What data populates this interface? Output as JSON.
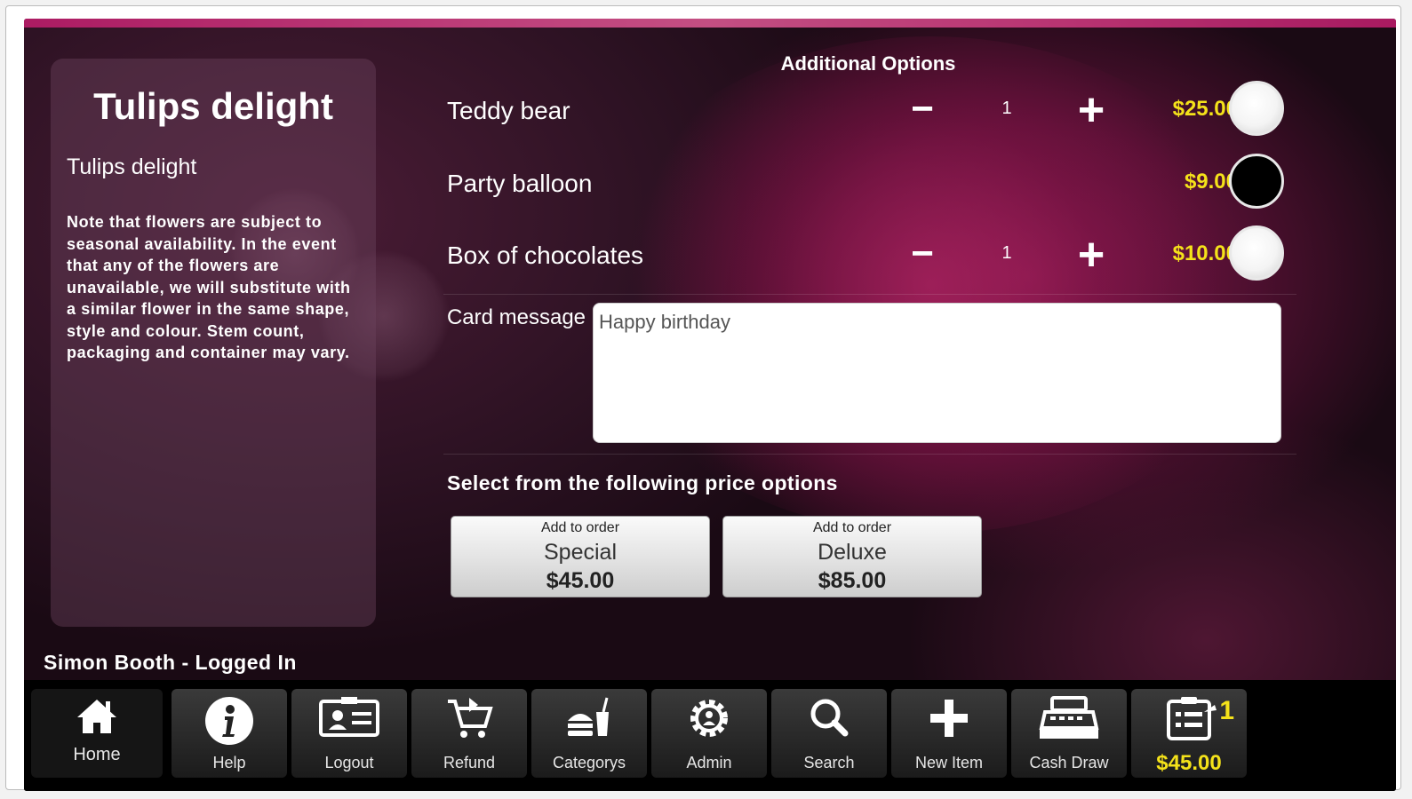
{
  "product": {
    "title": "Tulips delight",
    "subtitle": "Tulips delight",
    "description": "Note that flowers are subject to seasonal availability. In the event that any of the flowers are unavailable, we will substitute with a similar flower in the same shape, style and colour. Stem count, packaging and container may vary."
  },
  "options": {
    "heading": "Additional Options",
    "items": [
      {
        "label": "Teddy bear",
        "quantity": "1",
        "price": "$25.00",
        "has_stepper": true,
        "selected": true
      },
      {
        "label": "Party balloon",
        "price": "$9.00",
        "has_stepper": false,
        "selected": false
      },
      {
        "label": "Box of chocolates",
        "quantity": "1",
        "price": "$10.00",
        "has_stepper": true,
        "selected": true
      }
    ]
  },
  "card": {
    "label": "Card message",
    "value": "Happy birthday"
  },
  "price_options": {
    "heading": "Select from the following price options",
    "buttons": [
      {
        "caption": "Add to order",
        "name": "Special",
        "price": "$45.00"
      },
      {
        "caption": "Add to order",
        "name": "Deluxe",
        "price": "$85.00"
      }
    ]
  },
  "status": "Simon Booth - Logged In",
  "toolbar": {
    "items": [
      {
        "label": "Home",
        "icon": "home-icon"
      },
      {
        "label": "Help",
        "icon": "info-icon"
      },
      {
        "label": "Logout",
        "icon": "id-card-icon"
      },
      {
        "label": "Refund",
        "icon": "cart-return-icon"
      },
      {
        "label": "Categorys",
        "icon": "food-category-icon"
      },
      {
        "label": "Admin",
        "icon": "gear-icon"
      },
      {
        "label": "Search",
        "icon": "search-icon"
      },
      {
        "label": "New Item",
        "icon": "plus-icon"
      },
      {
        "label": "Cash Draw",
        "icon": "cash-register-icon"
      }
    ],
    "cart": {
      "icon": "order-list-icon",
      "count": "1",
      "total": "$45.00"
    }
  },
  "colors": {
    "accent_yellow": "#f4e21a",
    "brand_pink": "#c21d6e"
  }
}
